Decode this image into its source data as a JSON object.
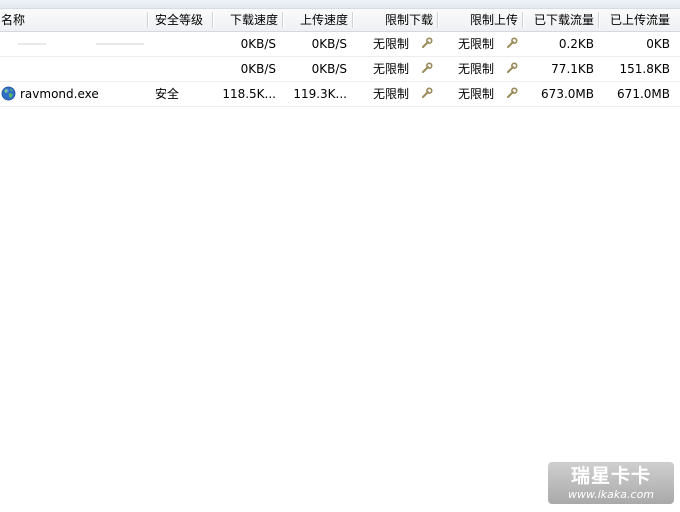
{
  "columns": {
    "name": "名称",
    "security_level": "安全等级",
    "download_speed": "下载速度",
    "upload_speed": "上传速度",
    "limit_download": "限制下载",
    "limit_upload": "限制上传",
    "downloaded": "已下载流量",
    "uploaded": "已上传流量"
  },
  "rows": [
    {
      "name": "",
      "security_level": "",
      "download_speed": "0KB/S",
      "upload_speed": "0KB/S",
      "limit_download": "无限制",
      "limit_upload": "无限制",
      "downloaded": "0.2KB",
      "uploaded": "0KB"
    },
    {
      "name": "",
      "security_level": "",
      "download_speed": "0KB/S",
      "upload_speed": "0KB/S",
      "limit_download": "无限制",
      "limit_upload": "无限制",
      "downloaded": "77.1KB",
      "uploaded": "151.8KB"
    },
    {
      "name": "ravmond.exe",
      "security_level": "安全",
      "download_speed": "118.5K...",
      "upload_speed": "119.3K...",
      "limit_download": "无限制",
      "limit_upload": "无限制",
      "downloaded": "673.0MB",
      "uploaded": "671.0MB",
      "icon": "globe-icon"
    }
  ],
  "icons": {
    "limit_edit": "wrench-icon",
    "process": "globe-icon"
  },
  "watermark": {
    "title": "瑞星卡卡",
    "url": "www.ikaka.com"
  }
}
